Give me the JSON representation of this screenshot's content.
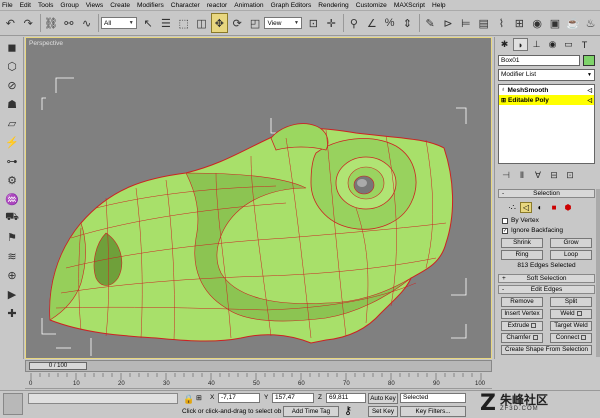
{
  "menubar": [
    "File",
    "Edit",
    "Tools",
    "Group",
    "Views",
    "Create",
    "Modifiers",
    "Character",
    "reactor",
    "Animation",
    "Graph Editors",
    "Rendering",
    "Customize",
    "MAXScript",
    "Help"
  ],
  "toolbar": {
    "selection_filter": "All",
    "ref_coord": "View"
  },
  "viewport": {
    "label": "Perspective",
    "mesh_color": "#a8e06a",
    "edge_color": "#cc2222"
  },
  "command_panel": {
    "object_name": "Box01",
    "object_color": "#7ed36a",
    "modifier_list": "Modifier List",
    "stack": [
      {
        "name": "MeshSmooth",
        "selected": false
      },
      {
        "name": "Editable Poly",
        "selected": true
      }
    ],
    "selection": {
      "title": "Selection",
      "by_vertex": "By Vertex",
      "ignore_backfacing": "Ignore Backfacing",
      "ignore_backfacing_checked": true,
      "shrink": "Shrink",
      "grow": "Grow",
      "ring": "Ring",
      "loop": "Loop",
      "status": "813 Edges Selected"
    },
    "soft_selection": {
      "title": "Soft Selection"
    },
    "edit_edges": {
      "title": "Edit Edges",
      "remove": "Remove",
      "split": "Split",
      "insert_vertex": "Insert Vertex",
      "weld": "Weld",
      "extrude": "Extrude",
      "target_weld": "Target Weld",
      "chamfer": "Chamfer",
      "connect": "Connect",
      "create_shape": "Create Shape From Selection"
    }
  },
  "timeline": {
    "slider": "0 / 100",
    "ticks": [
      "0",
      "10",
      "20",
      "30",
      "40",
      "50",
      "60",
      "70",
      "80",
      "90",
      "100"
    ]
  },
  "statusbar": {
    "x": "-7,17",
    "y": "157,47",
    "z": "69,811",
    "prompt": "Click or click-and-drag to select ob",
    "add_time_tag": "Add Time Tag",
    "auto_key": "Auto Key",
    "selected": "Selected",
    "set_key": "Set Key",
    "key_filters": "Key Filters...",
    "x_label": "X",
    "y_label": "Y",
    "z_label": "Z"
  },
  "watermark": {
    "logo": "Z",
    "name": "朱峰社区",
    "sub": "ZF3D.COM"
  }
}
